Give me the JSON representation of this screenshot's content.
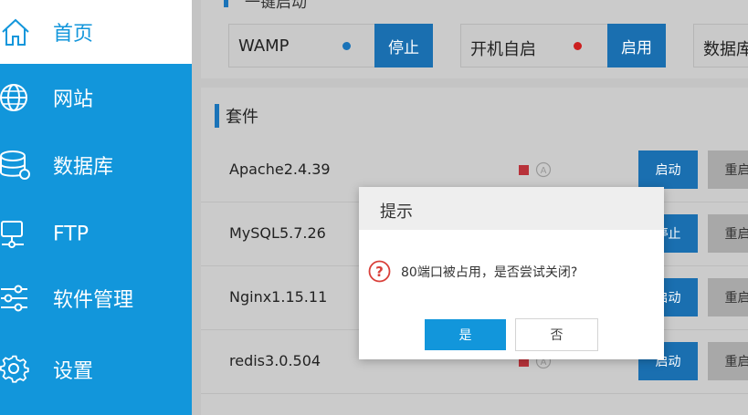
{
  "colors": {
    "accent": "#1296db",
    "button_blue": "#1a6fb0",
    "status_running": "#1a73b8",
    "status_stopped": "#cc1f1f",
    "status_square": "#b8323a",
    "sidebar_bg": "#1296db",
    "modal_header": "#eeeeee"
  },
  "sidebar": {
    "items": [
      {
        "label": "首页",
        "icon": "home-icon",
        "active": true
      },
      {
        "label": "网站",
        "icon": "globe-icon",
        "active": false
      },
      {
        "label": "数据库",
        "icon": "database-icon",
        "active": false
      },
      {
        "label": "FTP",
        "icon": "ftp-server-icon",
        "active": false
      },
      {
        "label": "软件管理",
        "icon": "sliders-icon",
        "active": false
      },
      {
        "label": "设置",
        "icon": "gear-icon",
        "active": false
      }
    ]
  },
  "quick_start": {
    "title": "一键启动",
    "controls": [
      {
        "name": "WAMP",
        "status": "running",
        "button": "停止"
      },
      {
        "name": "开机自启",
        "status": "stopped",
        "button": "启用"
      },
      {
        "name": "数据库",
        "status": "",
        "button": ""
      }
    ]
  },
  "suite": {
    "title": "套件",
    "rows": [
      {
        "name": "Apache2.4.39",
        "start_label": "启动",
        "restart_label": "重启"
      },
      {
        "name": "MySQL5.7.26",
        "start_label": "停止",
        "restart_label": "重启"
      },
      {
        "name": "Nginx1.15.11",
        "start_label": "启动",
        "restart_label": "重启"
      },
      {
        "name": "redis3.0.504",
        "start_label": "启动",
        "restart_label": "重启"
      }
    ],
    "auto_icon": "auto-start-circle-icon"
  },
  "modal": {
    "title": "提示",
    "message": "80端口被占用，是否尝试关闭?",
    "icon": "question-circle-icon",
    "yes_label": "是",
    "no_label": "否"
  }
}
